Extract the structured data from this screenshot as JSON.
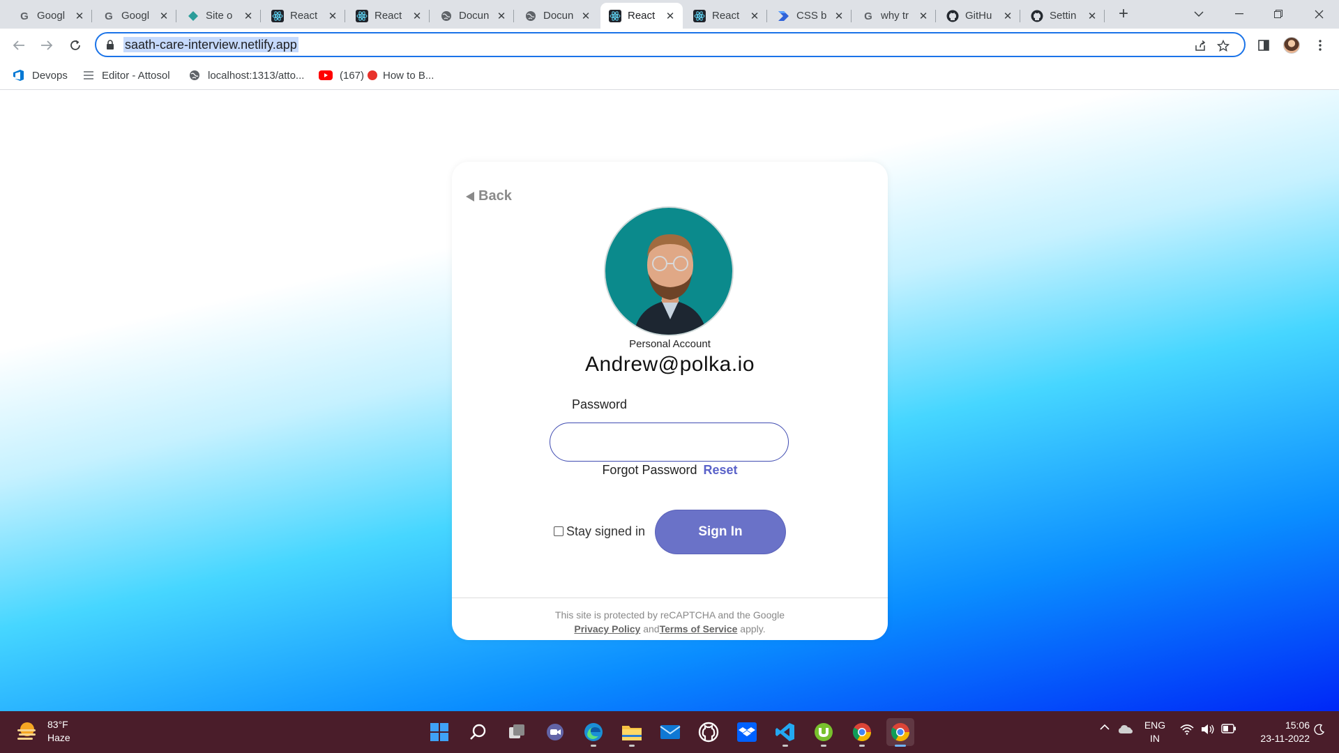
{
  "browser": {
    "tabs": [
      {
        "title": "Googl",
        "icon": "google-icon"
      },
      {
        "title": "Googl",
        "icon": "google-icon"
      },
      {
        "title": "Site o",
        "icon": "netlify-icon"
      },
      {
        "title": "React",
        "icon": "react-icon"
      },
      {
        "title": "React",
        "icon": "react-icon"
      },
      {
        "title": "Docun",
        "icon": "globe-icon"
      },
      {
        "title": "Docun",
        "icon": "globe-icon"
      },
      {
        "title": "React",
        "icon": "react-icon",
        "active": true
      },
      {
        "title": "React",
        "icon": "react-icon"
      },
      {
        "title": "CSS b",
        "icon": "powerautomate-icon"
      },
      {
        "title": "why tr",
        "icon": "google-icon"
      },
      {
        "title": "GitHu",
        "icon": "github-icon"
      },
      {
        "title": "Settin",
        "icon": "github-icon"
      }
    ],
    "url": "saath-care-interview.netlify.app",
    "bookmarks": [
      {
        "label": "Devops",
        "icon": "azure-devops-icon"
      },
      {
        "label": "Editor - Attosol",
        "icon": "lines-icon"
      },
      {
        "label": "localhost:1313/atto...",
        "icon": "globe-icon"
      },
      {
        "label": "(167)",
        "icon": "youtube-icon"
      },
      {
        "label": "How to B...",
        "icon": "red-dot-icon"
      }
    ]
  },
  "login": {
    "back_label": "Back",
    "account_type": "Personal Account",
    "email": "Andrew@polka.io",
    "password_label": "Password",
    "password_value": "",
    "forgot_text": "Forgot Password",
    "reset_label": "Reset",
    "stay_signed_in_label": "Stay signed in",
    "stay_signed_in_checked": false,
    "signin_label": "Sign In",
    "recaptcha_text": "This site is protected by reCAPTCHA and the Google",
    "privacy_label": "Privacy Policy",
    "and_text": "and",
    "terms_label": "Terms of Service",
    "apply_text": "apply."
  },
  "colors": {
    "accent_button": "#6a72c8",
    "link": "#5a62c9",
    "input_border": "#3f4bb1",
    "taskbar": "#4a1d2a"
  },
  "taskbar": {
    "weather_temp": "83°F",
    "weather_desc": "Haze",
    "apps": [
      "windows-start-icon",
      "search-icon",
      "task-view-icon",
      "teams-chat-icon",
      "edge-icon",
      "file-explorer-icon",
      "mail-icon",
      "github-desktop-icon",
      "dropbox-icon",
      "vscode-icon",
      "utorrent-icon",
      "chrome-icon",
      "chrome-icon"
    ],
    "lang_primary": "ENG",
    "lang_secondary": "IN",
    "time": "15:06",
    "date": "23-11-2022"
  }
}
